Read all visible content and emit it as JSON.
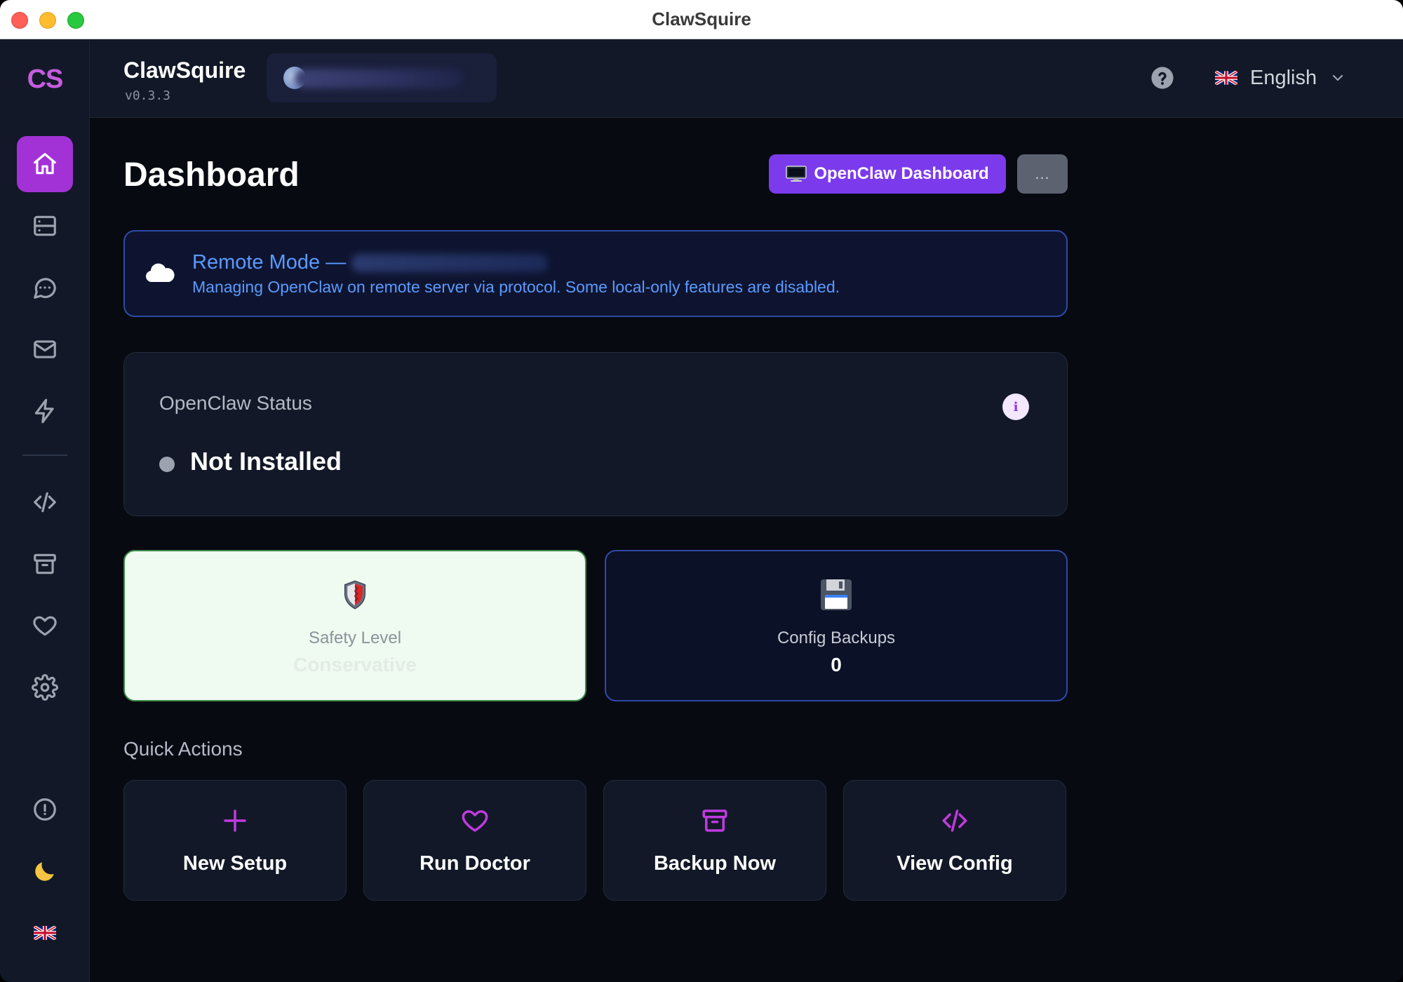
{
  "window": {
    "title": "ClawSquire"
  },
  "sidebar": {
    "logo": "CS",
    "items": [
      {
        "name": "nav-home",
        "icon": "home-icon",
        "active": true
      },
      {
        "name": "nav-servers",
        "icon": "server-icon",
        "active": false
      },
      {
        "name": "nav-chat",
        "icon": "chat-icon",
        "active": false
      },
      {
        "name": "nav-mail",
        "icon": "mail-icon",
        "active": false
      },
      {
        "name": "nav-actions",
        "icon": "bolt-icon",
        "active": false
      },
      {
        "name": "nav-config",
        "icon": "code-icon",
        "active": false
      },
      {
        "name": "nav-backups",
        "icon": "archive-icon",
        "active": false
      },
      {
        "name": "nav-doctor",
        "icon": "heart-icon",
        "active": false
      },
      {
        "name": "nav-settings",
        "icon": "gear-icon",
        "active": false
      }
    ],
    "bottom": [
      {
        "name": "nav-about",
        "icon": "alert-circle-icon"
      },
      {
        "name": "theme-toggle",
        "icon": "moon-icon"
      },
      {
        "name": "language-flag",
        "icon": "uk-flag-icon"
      }
    ]
  },
  "header": {
    "app_name": "ClawSquire",
    "version": "v0.3.3",
    "help_icon": "question-circle-icon",
    "language": "English"
  },
  "main": {
    "title": "Dashboard",
    "dashboard_button": "OpenClaw Dashboard",
    "more_button": "...",
    "remote": {
      "title": "Remote Mode —",
      "description": "Managing OpenClaw on remote server via protocol. Some local-only features are disabled."
    },
    "status": {
      "label": "OpenClaw Status",
      "value": "Not Installed",
      "info_icon": "i"
    },
    "stats": {
      "safety": {
        "label": "Safety Level",
        "value": "Conservative",
        "icon": "shield-icon"
      },
      "backups": {
        "label": "Config Backups",
        "value": "0",
        "icon": "floppy-disk-icon"
      }
    },
    "quick_actions": {
      "title": "Quick Actions",
      "items": [
        {
          "label": "New Setup",
          "icon": "plus-icon"
        },
        {
          "label": "Run Doctor",
          "icon": "heart-icon"
        },
        {
          "label": "Backup Now",
          "icon": "archive-icon"
        },
        {
          "label": "View Config",
          "icon": "code-icon"
        }
      ]
    }
  },
  "colors": {
    "accent": "#a332d6",
    "primary_button": "#7c3aed",
    "remote_text": "#5b9bff",
    "safety_card_bg": "#effaf0"
  }
}
